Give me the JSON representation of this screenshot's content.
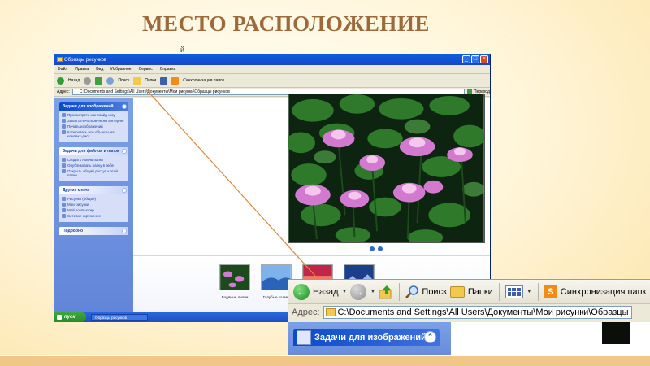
{
  "slide": {
    "title": "МЕСТО РАСПОЛОЖЕНИЕ",
    "mark": "й"
  },
  "window": {
    "title": "Образцы рисунков",
    "menu": [
      "Файл",
      "Правка",
      "Вид",
      "Избранное",
      "Сервис",
      "Справка"
    ],
    "toolbar": {
      "back": "Назад",
      "search": "Поиск",
      "folders": "Папки",
      "sync": "Синхронизация папок"
    },
    "address_label": "Адрес:",
    "address_value": "C:\\Documents and Settings\\All Users\\Документы\\Мои рисунки\\Образцы рисунков",
    "go_label": "Переход",
    "panels": [
      {
        "title": "Задачи для изображений",
        "items": [
          "Просмотреть как слайд-шоу",
          "Заказ отпечатков через Интернет",
          "Печать изображений",
          "Копировать все объекты на компакт-диск"
        ]
      },
      {
        "title": "Задачи для файлов и папок",
        "items": [
          "Создать новую папку",
          "Опубликовать папку в вебе",
          "Открыть общий доступ к этой папке"
        ]
      },
      {
        "title": "Другие места",
        "items": [
          "Рисунки (общие)",
          "Мои рисунки",
          "Мой компьютер",
          "Сетевое окружение"
        ]
      },
      {
        "title": "Подробно",
        "items": []
      }
    ],
    "thumbnails": [
      "Водяные лилии",
      "Голубые холмы",
      "Закат",
      "Зима"
    ],
    "taskbar": {
      "start": "пуск",
      "task": "Образцы рисунков"
    }
  },
  "zoom": {
    "back": "Назад",
    "search": "Поиск",
    "folders": "Папки",
    "sync": "Синхронизация папк",
    "address_label": "Адрес:",
    "address_value": "C:\\Documents and Settings\\All Users\\Документы\\Мои рисунки\\Образцы рисунков",
    "pane_title": "Задачи для изображений"
  },
  "colors": {
    "title": "#9c6a3a",
    "xp_blue": "#0b4ac9",
    "taskpane": "#6d8fd6",
    "start": "#2a8a2a",
    "connector": "#d98a3a"
  }
}
